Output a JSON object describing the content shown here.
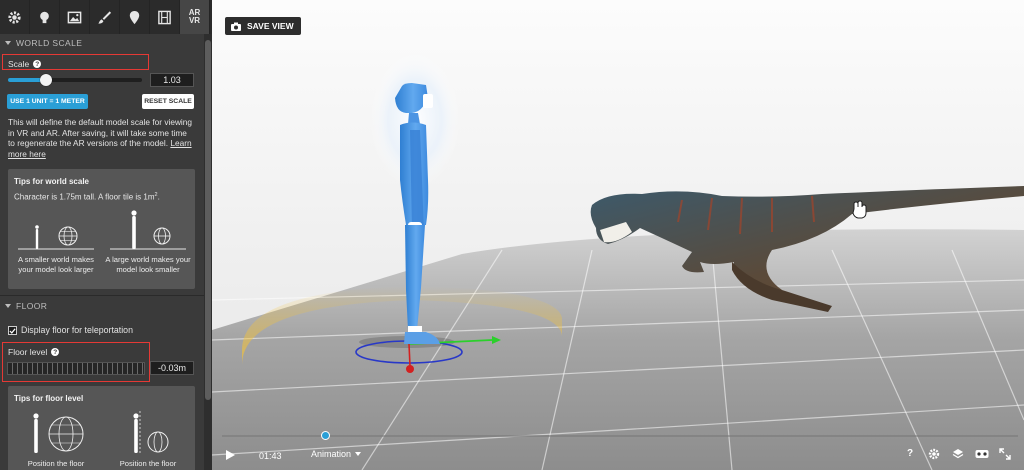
{
  "toolbar": {
    "tabs": [
      {
        "name": "gear-icon"
      },
      {
        "name": "lightbulb-icon"
      },
      {
        "name": "image-icon"
      },
      {
        "name": "brush-icon"
      },
      {
        "name": "map-pin-icon"
      },
      {
        "name": "film-icon"
      },
      {
        "name": "ar-vr-icon",
        "label_top": "AR",
        "label_bottom": "VR"
      }
    ]
  },
  "world_scale": {
    "header": "WORLD SCALE",
    "scale_label": "Scale",
    "help_glyph": "?",
    "scale_value": "1.03",
    "slider_level": 0.28,
    "use_unit_button": "USE 1 UNIT = 1 METER",
    "reset_button": "RESET SCALE",
    "description": "This will define the default model scale for viewing in VR and AR. After saving, it will take some time to regenerate the AR versions of the model.",
    "learn_more": "Learn more here",
    "tips": {
      "title": "Tips for world scale",
      "subtitle": "Character is 1.75m tall. A floor tile is 1m",
      "subtitle_sup": "2",
      "subtitle_end": ".",
      "left_caption": "A smaller world makes your model look larger",
      "right_caption": "A large world makes your model look smaller"
    }
  },
  "floor": {
    "header": "FLOOR",
    "display_floor_label": "Display floor for teleportation",
    "display_floor_checked": true,
    "floor_level_label": "Floor level",
    "help_glyph": "?",
    "floor_value": "-0.03m",
    "tips": {
      "title": "Tips for floor level",
      "left_caption": "Position the floor",
      "right_caption": "Position the floor"
    }
  },
  "viewport": {
    "save_view_label": "SAVE VIEW",
    "time": "01:43",
    "animation_label": "Animation",
    "timeline_level": 0.13
  },
  "colors": {
    "accent": "#2a9fd6",
    "highlight": "#e53935",
    "sidebar_bg": "#3a3a3a"
  }
}
